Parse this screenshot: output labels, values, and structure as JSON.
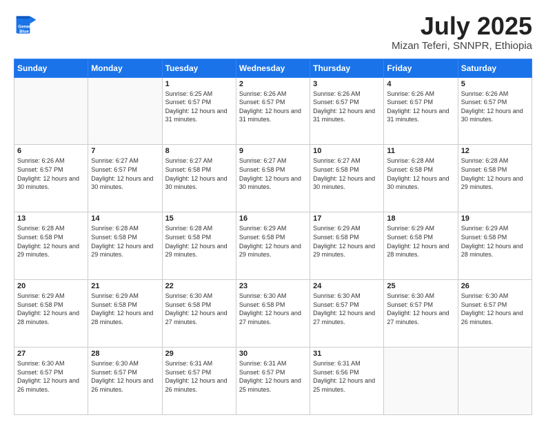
{
  "header": {
    "logo_line1": "General",
    "logo_line2": "Blue",
    "title": "July 2025",
    "subtitle": "Mizan Teferi, SNNPR, Ethiopia"
  },
  "weekdays": [
    "Sunday",
    "Monday",
    "Tuesday",
    "Wednesday",
    "Thursday",
    "Friday",
    "Saturday"
  ],
  "weeks": [
    [
      {
        "day": "",
        "sunrise": "",
        "sunset": "",
        "daylight": ""
      },
      {
        "day": "",
        "sunrise": "",
        "sunset": "",
        "daylight": ""
      },
      {
        "day": "1",
        "sunrise": "Sunrise: 6:25 AM",
        "sunset": "Sunset: 6:57 PM",
        "daylight": "Daylight: 12 hours and 31 minutes."
      },
      {
        "day": "2",
        "sunrise": "Sunrise: 6:26 AM",
        "sunset": "Sunset: 6:57 PM",
        "daylight": "Daylight: 12 hours and 31 minutes."
      },
      {
        "day": "3",
        "sunrise": "Sunrise: 6:26 AM",
        "sunset": "Sunset: 6:57 PM",
        "daylight": "Daylight: 12 hours and 31 minutes."
      },
      {
        "day": "4",
        "sunrise": "Sunrise: 6:26 AM",
        "sunset": "Sunset: 6:57 PM",
        "daylight": "Daylight: 12 hours and 31 minutes."
      },
      {
        "day": "5",
        "sunrise": "Sunrise: 6:26 AM",
        "sunset": "Sunset: 6:57 PM",
        "daylight": "Daylight: 12 hours and 30 minutes."
      }
    ],
    [
      {
        "day": "6",
        "sunrise": "Sunrise: 6:26 AM",
        "sunset": "Sunset: 6:57 PM",
        "daylight": "Daylight: 12 hours and 30 minutes."
      },
      {
        "day": "7",
        "sunrise": "Sunrise: 6:27 AM",
        "sunset": "Sunset: 6:57 PM",
        "daylight": "Daylight: 12 hours and 30 minutes."
      },
      {
        "day": "8",
        "sunrise": "Sunrise: 6:27 AM",
        "sunset": "Sunset: 6:58 PM",
        "daylight": "Daylight: 12 hours and 30 minutes."
      },
      {
        "day": "9",
        "sunrise": "Sunrise: 6:27 AM",
        "sunset": "Sunset: 6:58 PM",
        "daylight": "Daylight: 12 hours and 30 minutes."
      },
      {
        "day": "10",
        "sunrise": "Sunrise: 6:27 AM",
        "sunset": "Sunset: 6:58 PM",
        "daylight": "Daylight: 12 hours and 30 minutes."
      },
      {
        "day": "11",
        "sunrise": "Sunrise: 6:28 AM",
        "sunset": "Sunset: 6:58 PM",
        "daylight": "Daylight: 12 hours and 30 minutes."
      },
      {
        "day": "12",
        "sunrise": "Sunrise: 6:28 AM",
        "sunset": "Sunset: 6:58 PM",
        "daylight": "Daylight: 12 hours and 29 minutes."
      }
    ],
    [
      {
        "day": "13",
        "sunrise": "Sunrise: 6:28 AM",
        "sunset": "Sunset: 6:58 PM",
        "daylight": "Daylight: 12 hours and 29 minutes."
      },
      {
        "day": "14",
        "sunrise": "Sunrise: 6:28 AM",
        "sunset": "Sunset: 6:58 PM",
        "daylight": "Daylight: 12 hours and 29 minutes."
      },
      {
        "day": "15",
        "sunrise": "Sunrise: 6:28 AM",
        "sunset": "Sunset: 6:58 PM",
        "daylight": "Daylight: 12 hours and 29 minutes."
      },
      {
        "day": "16",
        "sunrise": "Sunrise: 6:29 AM",
        "sunset": "Sunset: 6:58 PM",
        "daylight": "Daylight: 12 hours and 29 minutes."
      },
      {
        "day": "17",
        "sunrise": "Sunrise: 6:29 AM",
        "sunset": "Sunset: 6:58 PM",
        "daylight": "Daylight: 12 hours and 29 minutes."
      },
      {
        "day": "18",
        "sunrise": "Sunrise: 6:29 AM",
        "sunset": "Sunset: 6:58 PM",
        "daylight": "Daylight: 12 hours and 28 minutes."
      },
      {
        "day": "19",
        "sunrise": "Sunrise: 6:29 AM",
        "sunset": "Sunset: 6:58 PM",
        "daylight": "Daylight: 12 hours and 28 minutes."
      }
    ],
    [
      {
        "day": "20",
        "sunrise": "Sunrise: 6:29 AM",
        "sunset": "Sunset: 6:58 PM",
        "daylight": "Daylight: 12 hours and 28 minutes."
      },
      {
        "day": "21",
        "sunrise": "Sunrise: 6:29 AM",
        "sunset": "Sunset: 6:58 PM",
        "daylight": "Daylight: 12 hours and 28 minutes."
      },
      {
        "day": "22",
        "sunrise": "Sunrise: 6:30 AM",
        "sunset": "Sunset: 6:58 PM",
        "daylight": "Daylight: 12 hours and 27 minutes."
      },
      {
        "day": "23",
        "sunrise": "Sunrise: 6:30 AM",
        "sunset": "Sunset: 6:58 PM",
        "daylight": "Daylight: 12 hours and 27 minutes."
      },
      {
        "day": "24",
        "sunrise": "Sunrise: 6:30 AM",
        "sunset": "Sunset: 6:57 PM",
        "daylight": "Daylight: 12 hours and 27 minutes."
      },
      {
        "day": "25",
        "sunrise": "Sunrise: 6:30 AM",
        "sunset": "Sunset: 6:57 PM",
        "daylight": "Daylight: 12 hours and 27 minutes."
      },
      {
        "day": "26",
        "sunrise": "Sunrise: 6:30 AM",
        "sunset": "Sunset: 6:57 PM",
        "daylight": "Daylight: 12 hours and 26 minutes."
      }
    ],
    [
      {
        "day": "27",
        "sunrise": "Sunrise: 6:30 AM",
        "sunset": "Sunset: 6:57 PM",
        "daylight": "Daylight: 12 hours and 26 minutes."
      },
      {
        "day": "28",
        "sunrise": "Sunrise: 6:30 AM",
        "sunset": "Sunset: 6:57 PM",
        "daylight": "Daylight: 12 hours and 26 minutes."
      },
      {
        "day": "29",
        "sunrise": "Sunrise: 6:31 AM",
        "sunset": "Sunset: 6:57 PM",
        "daylight": "Daylight: 12 hours and 26 minutes."
      },
      {
        "day": "30",
        "sunrise": "Sunrise: 6:31 AM",
        "sunset": "Sunset: 6:57 PM",
        "daylight": "Daylight: 12 hours and 25 minutes."
      },
      {
        "day": "31",
        "sunrise": "Sunrise: 6:31 AM",
        "sunset": "Sunset: 6:56 PM",
        "daylight": "Daylight: 12 hours and 25 minutes."
      },
      {
        "day": "",
        "sunrise": "",
        "sunset": "",
        "daylight": ""
      },
      {
        "day": "",
        "sunrise": "",
        "sunset": "",
        "daylight": ""
      }
    ]
  ]
}
